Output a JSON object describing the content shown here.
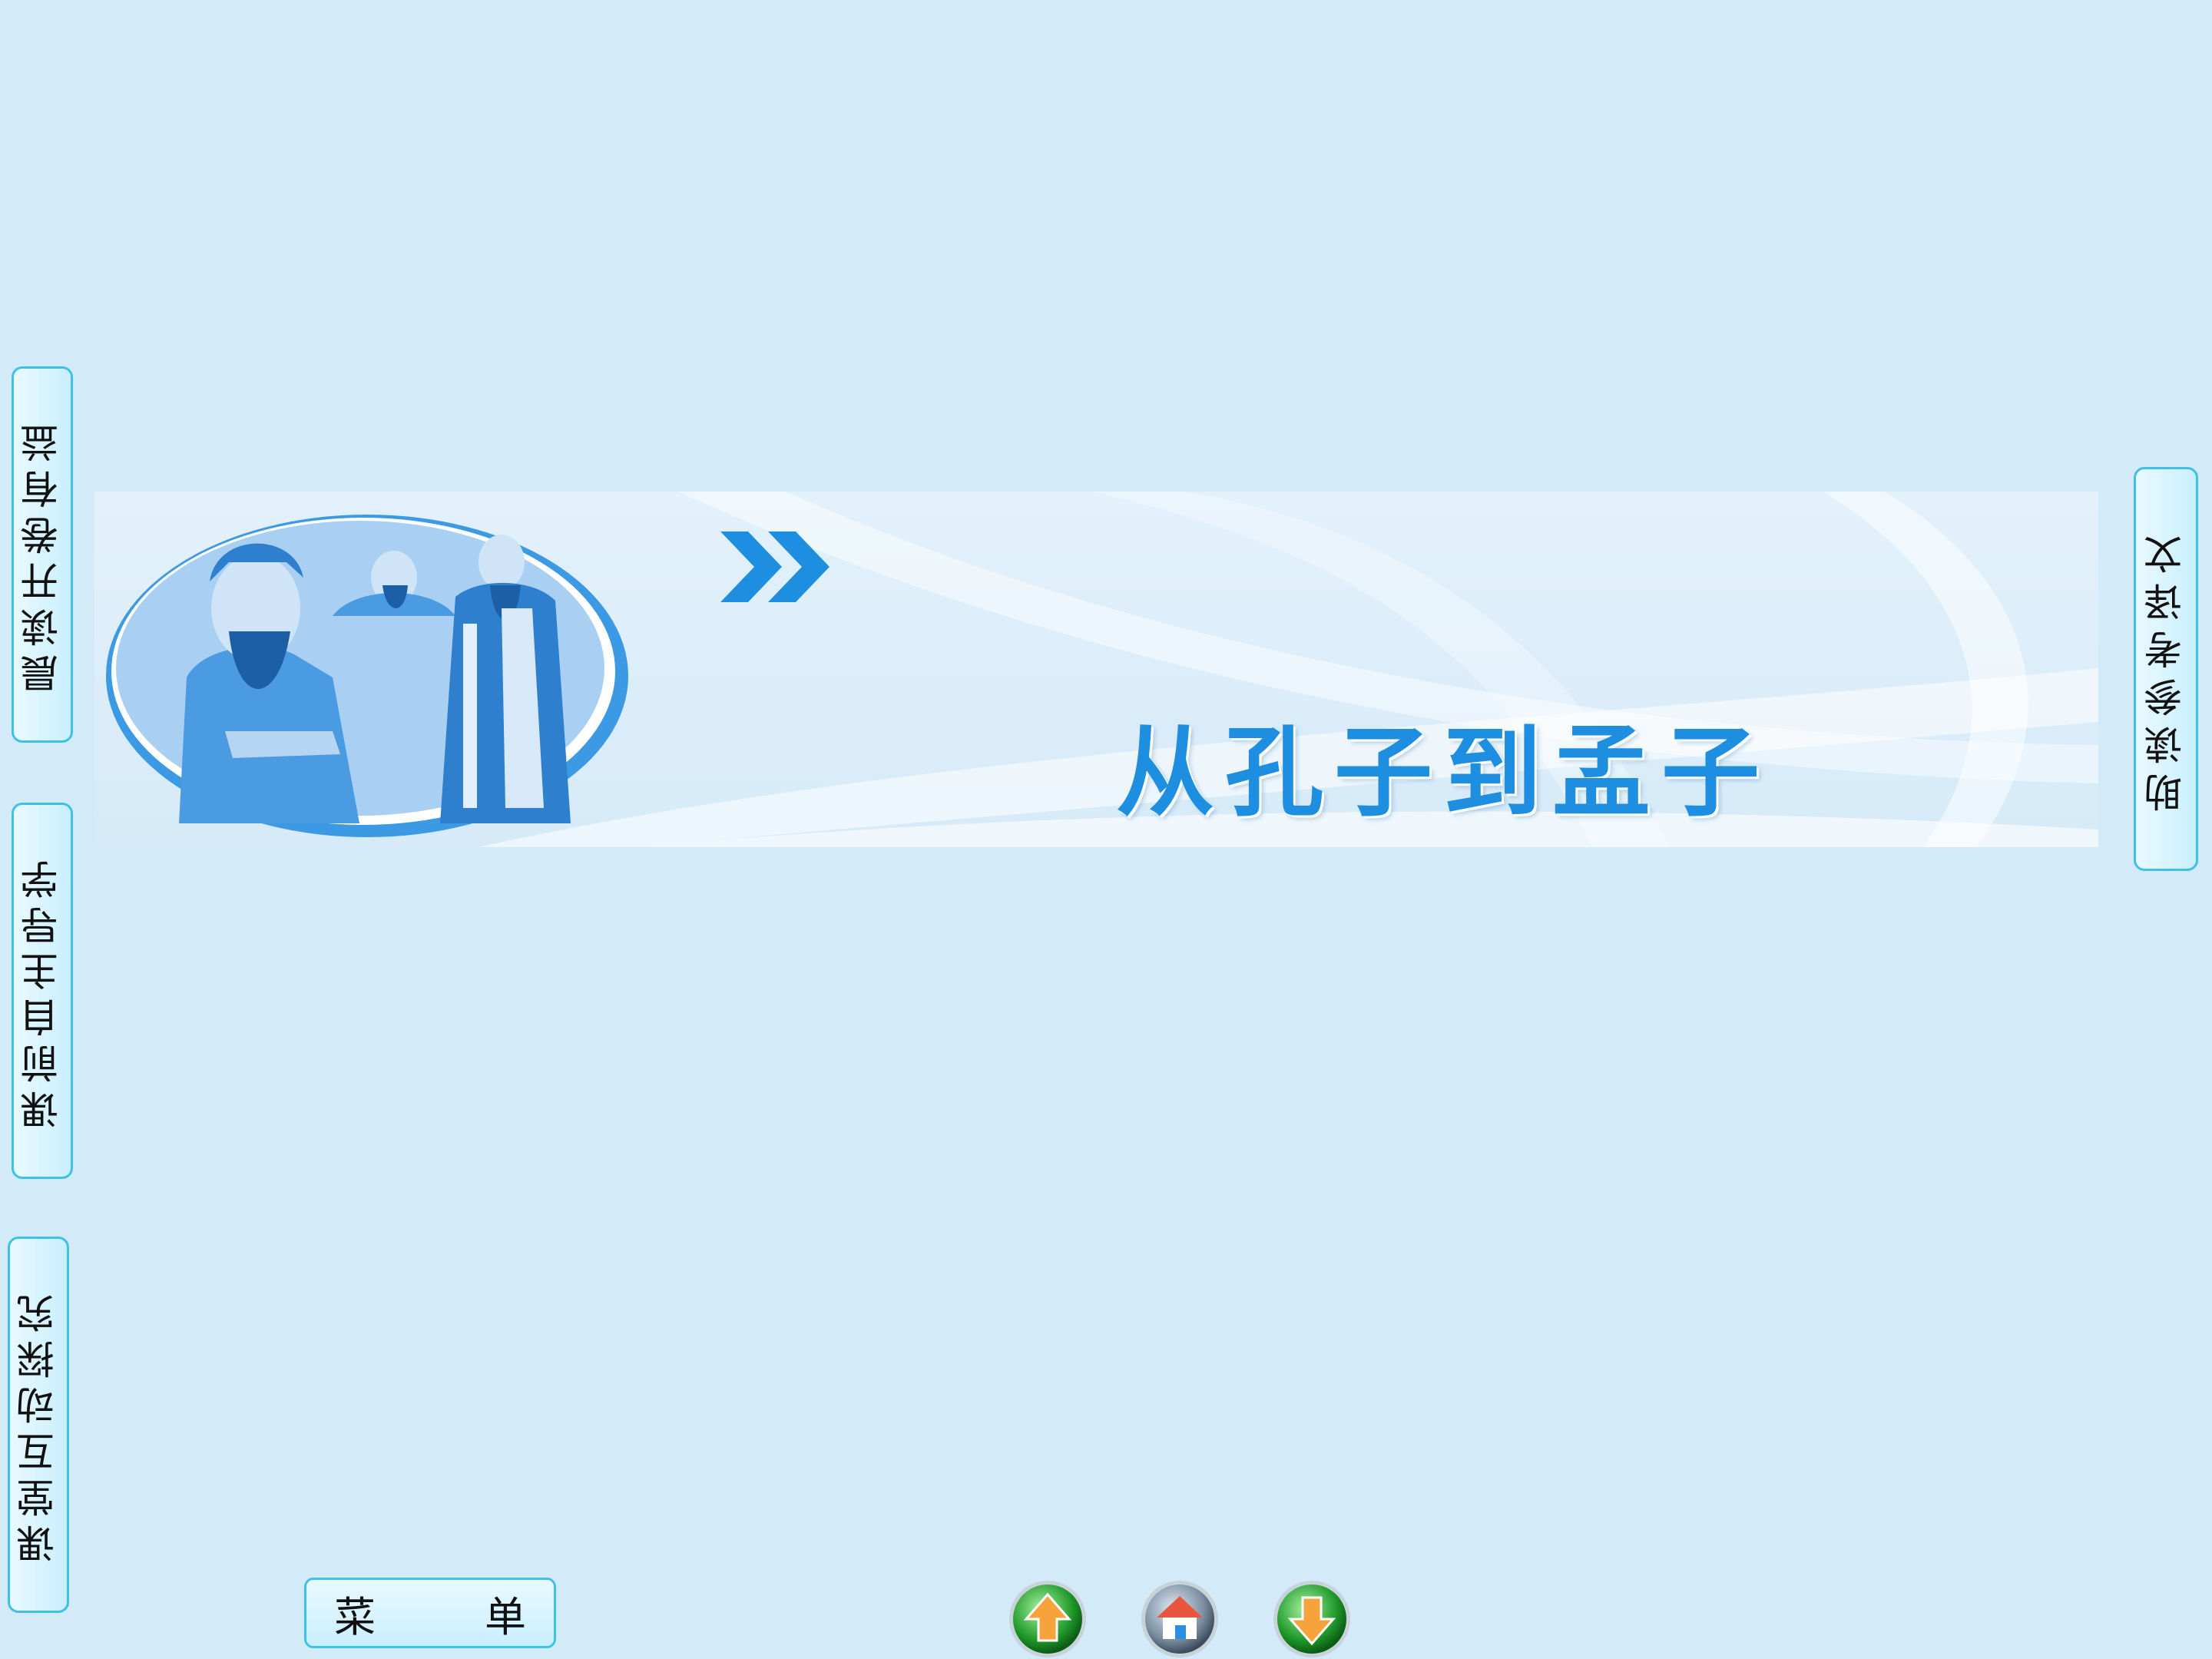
{
  "left_nav": {
    "tab1": "晨读开卷有益",
    "tab2": "课前自主导学",
    "tab3": "课堂互动探究"
  },
  "right_nav": {
    "tab1": "助读参考译文"
  },
  "banner": {
    "title": "从孔子到孟子"
  },
  "bottom_bar": {
    "menu_char1": "菜",
    "menu_char2": "单"
  },
  "colors": {
    "background": "#d3eaf8",
    "accent_border": "#3fc0e6",
    "title_blue": "#1e8fe0"
  },
  "icons": {
    "up": "arrow-up-icon",
    "home": "home-icon",
    "down": "arrow-down-icon"
  }
}
